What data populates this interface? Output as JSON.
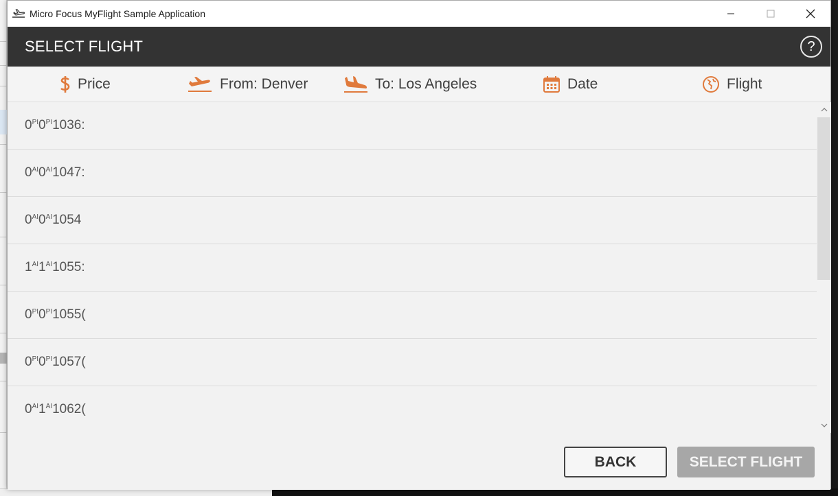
{
  "window": {
    "title": "Micro Focus MyFlight Sample Application"
  },
  "header": {
    "title": "SELECT FLIGHT",
    "help_label": "?"
  },
  "columns": [
    {
      "label": "Price",
      "icon": "dollar-icon"
    },
    {
      "label": "From: Denver",
      "icon": "takeoff-icon"
    },
    {
      "label": "To: Los Angeles",
      "icon": "landing-icon"
    },
    {
      "label": "Date",
      "icon": "calendar-icon"
    },
    {
      "label": "Flight",
      "icon": "globe-icon"
    }
  ],
  "rows": [
    {
      "a": "0",
      "a_sup": "PI",
      "b": "0",
      "b_sup": "PI",
      "flight": "1036:"
    },
    {
      "a": "0",
      "a_sup": "AI",
      "b": "0",
      "b_sup": "AI",
      "flight": "1047:"
    },
    {
      "a": "0",
      "a_sup": "AI",
      "b": "0",
      "b_sup": "AI",
      "flight": "1054"
    },
    {
      "a": "1",
      "a_sup": "AI",
      "b": "1",
      "b_sup": "AI",
      "flight": "1055:"
    },
    {
      "a": "0",
      "a_sup": "PI",
      "b": "0",
      "b_sup": "PI",
      "flight": "1055("
    },
    {
      "a": "0",
      "a_sup": "PI",
      "b": "0",
      "b_sup": "PI",
      "flight": "1057("
    },
    {
      "a": "0",
      "a_sup": "AI",
      "b": "1",
      "b_sup": "AI",
      "flight": "1062("
    }
  ],
  "footer": {
    "back_label": "BACK",
    "select_label": "SELECT FLIGHT"
  },
  "colors": {
    "accent": "#e07a3c",
    "header_bg": "#333333",
    "disabled_button": "#a7a7a7"
  }
}
